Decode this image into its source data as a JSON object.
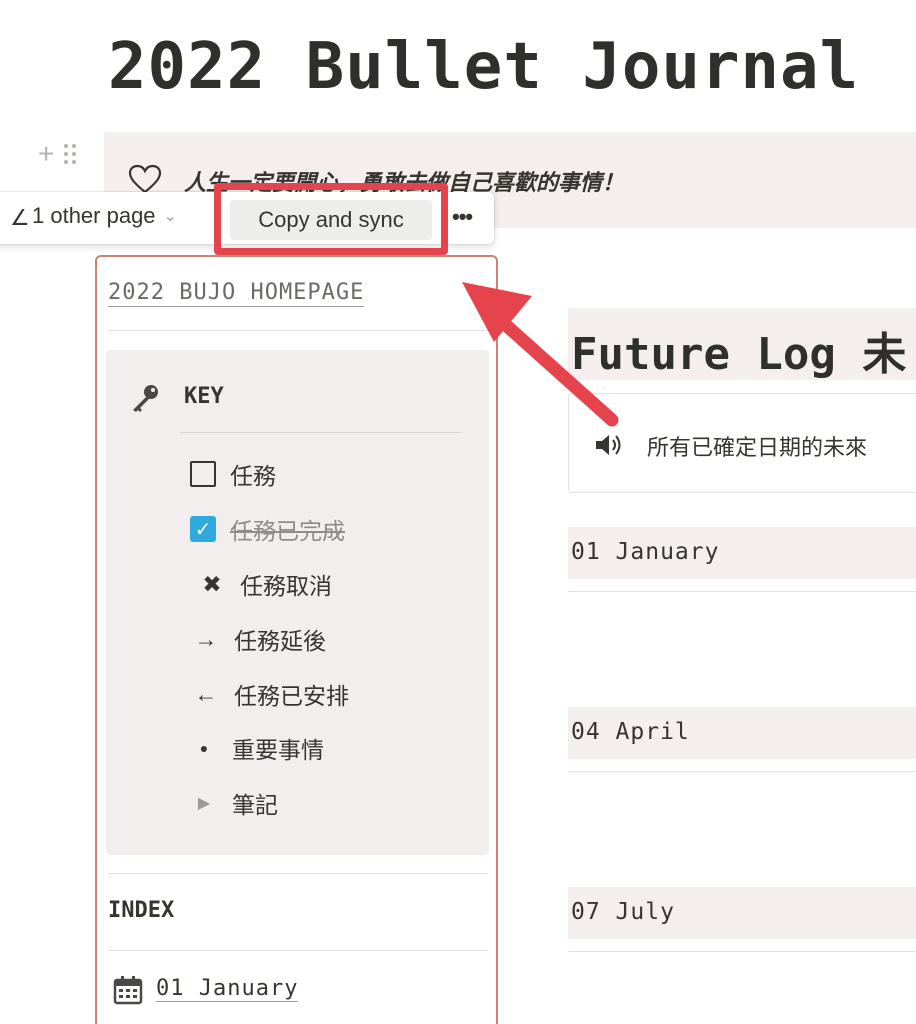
{
  "page": {
    "title": "2022 Bullet Journal"
  },
  "callout": {
    "text": "人生一定要開心，勇敢去做自己喜歡的事情！",
    "icon": "heart-icon"
  },
  "sync_toolbar": {
    "edit_glyph": "∠",
    "other_pages_label": "1 other page",
    "copy_sync_label": "Copy and sync",
    "more_glyph": "•••"
  },
  "synced_block": {
    "homepage_link": "2022 BUJO HOMEPAGE",
    "key": {
      "title": "KEY",
      "items": [
        {
          "symbol": "checkbox-empty",
          "label": "任務"
        },
        {
          "symbol": "checkbox-checked",
          "label": "任務已完成"
        },
        {
          "symbol": "✖",
          "label": "任務取消"
        },
        {
          "symbol": "→",
          "label": "任務延後"
        },
        {
          "symbol": "←",
          "label": "任務已安排"
        },
        {
          "symbol": "●",
          "label": "重要事情"
        },
        {
          "symbol": "▶",
          "label": "筆記"
        }
      ]
    },
    "index": {
      "title": "INDEX",
      "items": [
        {
          "icon": "calendar-icon",
          "label": "01 January"
        }
      ]
    }
  },
  "future_log": {
    "title": "Future Log 未",
    "callout_text": "所有已確定日期的未來",
    "months": [
      "01 January",
      "04 April",
      "07 July"
    ]
  },
  "colors": {
    "highlight": "#e5444d",
    "synced_border": "#cf8272",
    "panel_bg": "#f3eeee",
    "checkbox_blue": "#2eaadc"
  }
}
